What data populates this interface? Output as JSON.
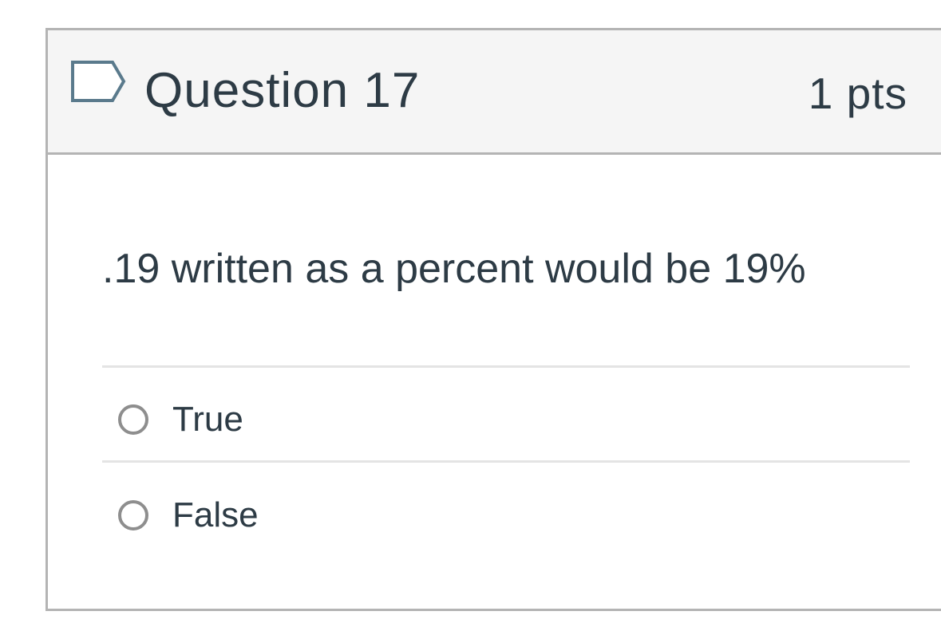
{
  "question": {
    "title": "Question 17",
    "points": "1 pts",
    "flag_icon": "flag-icon",
    "text": ".19 written as a percent would be 19%",
    "answers": [
      {
        "label": "True",
        "selected": false
      },
      {
        "label": "False",
        "selected": false
      }
    ]
  },
  "colors": {
    "header_background": "#f5f5f5",
    "border": "#b4b4b4",
    "text": "#2d3b45",
    "radio_border": "#8e8e8e",
    "divider": "#e4e4e4"
  }
}
